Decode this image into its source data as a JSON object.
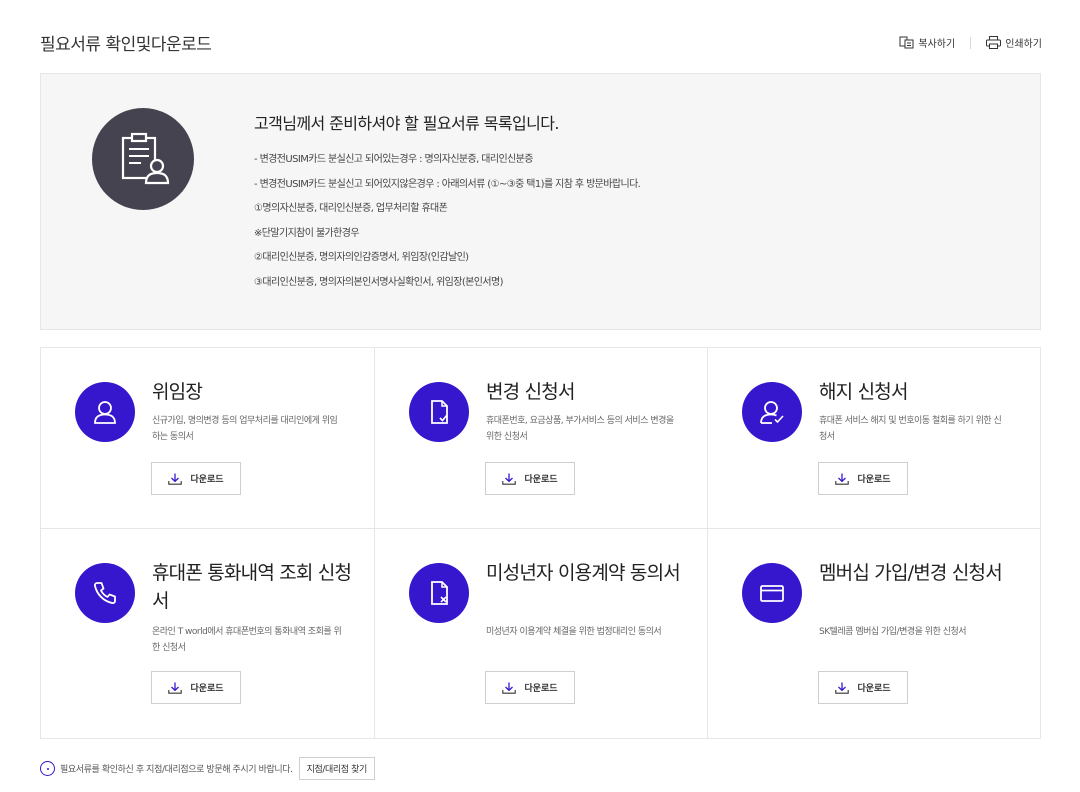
{
  "header": {
    "title": "필요서류 확인및다운로드",
    "copy_label": "복사하기",
    "print_label": "인쇄하기"
  },
  "summary": {
    "icon": "document-person-icon",
    "heading": "고객님께서 준비하셔야 할 필요서류 목록입니다.",
    "lines": [
      "- 변경전USIM카드 분실신고 되어있는경우 : 명의자신분증, 대리인신분증",
      "- 변경전USIM카드 분실신고 되어있지않은경우 : 아래의서류 (①~③중 택1)를 지참 후 방문바랍니다.",
      "①명의자신분증, 대리인신분증, 업무처리할 휴대폰",
      "※단말기지참이 불가한경우",
      "②대리인신분증, 명의자의인감증명서, 위임장(인감날인)",
      "③대리인신분증, 명의자의본인서명사실확인서, 위임장(본인서명)"
    ]
  },
  "documents": [
    {
      "icon": "person-icon",
      "title": "위임장",
      "desc": "신규가입, 명의변경 등의 업무처리를 대리인에게 위임하는 동의서",
      "button": "다운로드"
    },
    {
      "icon": "document-check-icon",
      "title": "변경 신청서",
      "desc": "휴대폰번호, 요금상품, 부가서비스 등의 서비스 변경을 위한 신청서",
      "button": "다운로드"
    },
    {
      "icon": "person-check-icon",
      "title": "해지 신청서",
      "desc": "휴대폰 서비스 해지 및 번호이동 철회를 하기 위한 신청서",
      "button": "다운로드"
    },
    {
      "icon": "phone-icon",
      "title": "휴대폰 통화내역 조회 신청서",
      "desc": "온라인 T world에서 휴대폰번호의 통화내역 조회를 위한 신청서",
      "button": "다운로드"
    },
    {
      "icon": "document-x-icon",
      "title": "미성년자 이용계약 동의서",
      "desc": "미성년자 이용계약 체결을 위한 법정대리인 동의서",
      "button": "다운로드"
    },
    {
      "icon": "card-icon",
      "title": "멤버십 가입/변경 신청서",
      "desc": "SK텔레콤 멤버십 가입/변경을 위한 신청서",
      "button": "다운로드"
    }
  ],
  "footer": {
    "note": "필요서류를 확인하신 후 지점/대리점으로 방문해 주시기 바랍니다.",
    "find_store_label": "지점/대리점 찾기"
  },
  "colors": {
    "accent": "#3617ce",
    "summary_icon_bg": "#45434f",
    "summary_bg": "#f6f6f6"
  }
}
